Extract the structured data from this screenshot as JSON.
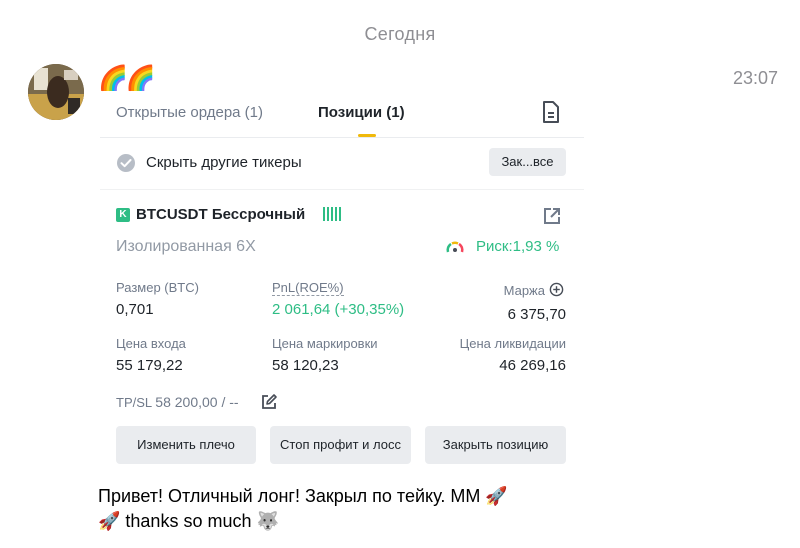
{
  "chat": {
    "date_separator": "Сегодня",
    "time": "23:07",
    "emoji_line": "🌈🌈",
    "message_line1": "Привет! Отличный лонг! Закрыл по тейку. ММ 🚀",
    "message_line2": "🚀 thanks so much 🐺"
  },
  "screenshot": {
    "tabs": [
      {
        "label": "Открытые ордера (1)",
        "active": false
      },
      {
        "label": "Позиции  (1)",
        "active": true
      }
    ],
    "hide_other_tickers": "Скрыть другие тикеры",
    "close_all_button": "Зак...все",
    "position": {
      "badge": "K",
      "symbol": "BTCUSDT Бессрочный",
      "margin_mode": "Изолированная 6X",
      "risk": "Риск:1,93 %",
      "size_label": "Размер (BTC)",
      "size_value": "0,701",
      "pnl_label": "PnL(ROE%)",
      "pnl_value": "2 061,64 (+30,35%)",
      "margin_label": "Маржа",
      "margin_value": "6 375,70",
      "entry_label": "Цена входа",
      "entry_value": "55 179,22",
      "mark_label": "Цена маркировки",
      "mark_value": "58 120,23",
      "liq_label": "Цена ликвидации",
      "liq_value": "46 269,16",
      "tpsl_label": "TP/SL",
      "tpsl_value": "58 200,00 / --"
    },
    "buttons": {
      "leverage": "Изменить плечо",
      "stop_profit": "Стоп профит и лосс",
      "close_position": "Закрыть позицию"
    }
  },
  "colors": {
    "accent": "#f0b90b",
    "green": "#2ebd85",
    "muted": "#707a8a"
  }
}
